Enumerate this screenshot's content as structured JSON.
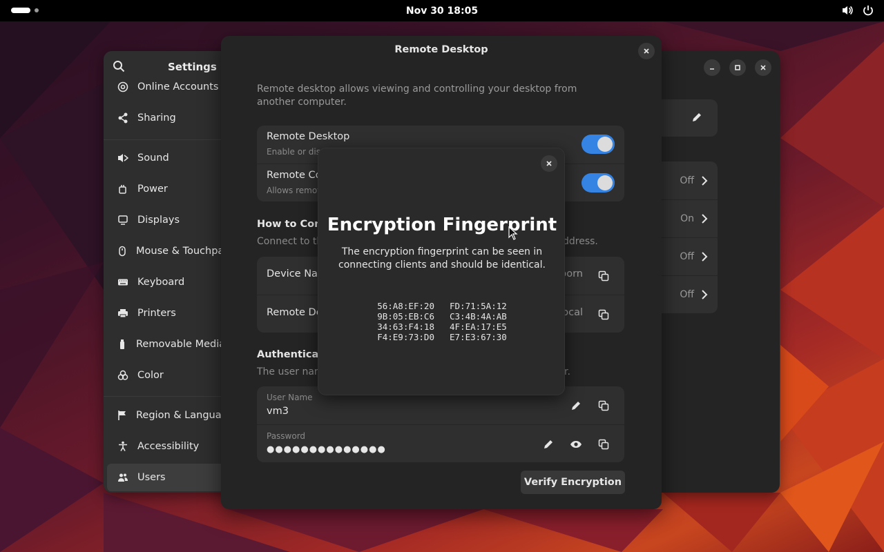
{
  "topbar": {
    "clock": "Nov 30  18:05"
  },
  "settings": {
    "title": "Settings",
    "sidebar": [
      {
        "label": "Online Accounts",
        "icon": "at-icon"
      },
      {
        "label": "Sharing",
        "icon": "share-icon"
      },
      {
        "label": "Sound",
        "icon": "speaker-icon"
      },
      {
        "label": "Power",
        "icon": "power-plug-icon"
      },
      {
        "label": "Displays",
        "icon": "display-icon"
      },
      {
        "label": "Mouse & Touchpad",
        "icon": "mouse-icon"
      },
      {
        "label": "Keyboard",
        "icon": "keyboard-icon"
      },
      {
        "label": "Printers",
        "icon": "printer-icon"
      },
      {
        "label": "Removable Media",
        "icon": "usb-icon"
      },
      {
        "label": "Color",
        "icon": "color-icon"
      },
      {
        "label": "Region & Language",
        "icon": "flag-icon"
      },
      {
        "label": "Accessibility",
        "icon": "accessibility-icon"
      },
      {
        "label": "Users",
        "icon": "users-icon"
      }
    ],
    "bg_rows": [
      "Off",
      "On",
      "Off",
      "Off"
    ]
  },
  "remote_desktop": {
    "title": "Remote Desktop",
    "description": "Remote desktop allows viewing and controlling your desktop from another computer.",
    "toggles": [
      {
        "title": "Remote Desktop",
        "subtitle": "Enable or disa",
        "on": true
      },
      {
        "title": "Remote Co",
        "subtitle": "Allows remot",
        "on": true
      }
    ],
    "how_to_heading": "How to Conn",
    "how_to_sub": "Connect to thi",
    "how_to_sub_end": "ddress.",
    "device_rows": [
      {
        "name": "Device Nam",
        "value": "porn"
      },
      {
        "name": "Remote De",
        "value": "ocal"
      }
    ],
    "auth_heading": "Authenticati",
    "auth_sub": "The user nam",
    "auth_sub_end": "r.",
    "username_caption": "User Name",
    "username": "vm3",
    "password_caption": "Password",
    "password": "●●●●●●●●●●●●●●",
    "verify_button": "Verify Encryption"
  },
  "fingerprint": {
    "title": "Encryption Fingerprint",
    "description": "The encryption fingerprint can be seen in connecting clients and should be identical.",
    "lines": [
      [
        "56:A8:EF:20",
        "FD:71:5A:12"
      ],
      [
        "9B:05:EB:C6",
        "C3:4B:4A:AB"
      ],
      [
        "34:63:F4:18",
        "4F:EA:17:E5"
      ],
      [
        "F4:E9:73:D0",
        "E7:E3:67:30"
      ]
    ]
  },
  "colors": {
    "accent": "#3584e4",
    "dialog_bg": "#242424",
    "card_bg": "#2f2f2f"
  }
}
